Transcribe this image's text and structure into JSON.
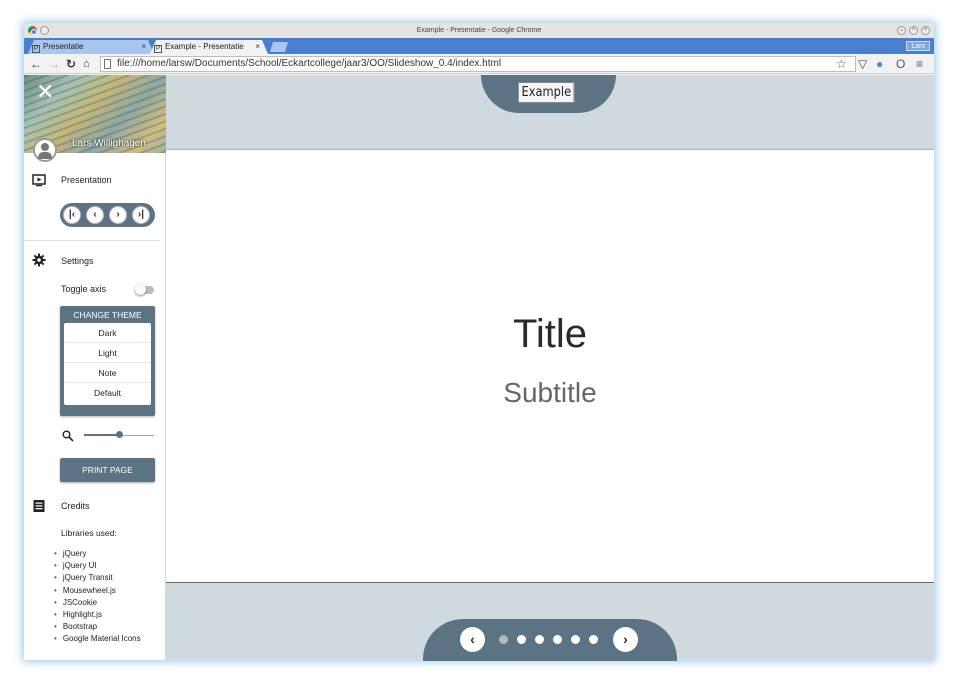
{
  "browser": {
    "window_title": "Example - Presentatie - Google Chrome",
    "tabs": [
      {
        "label": "Presentatie",
        "favicon": "P"
      },
      {
        "label": "Example - Presentatie",
        "favicon": "P"
      }
    ],
    "profile": "Lars",
    "url": "file:///home/larsw/Documents/School/Eckartcollege/jaar3/OO/Slideshow_0.4/index.html"
  },
  "sidebar": {
    "user_name": "Lars Willighagen",
    "presentation_label": "Presentation",
    "settings_label": "Settings",
    "toggle_axis_label": "Toggle axis",
    "change_theme_label": "CHANGE THEME",
    "themes": [
      "Dark",
      "Light",
      "Note",
      "Default"
    ],
    "zoom_level": 0.5,
    "print_label": "PRINT PAGE",
    "credits_label": "Credits",
    "libraries_title": "Libraries used:",
    "libraries": [
      "jQuery",
      "jQuery UI",
      "jQuery Transit",
      "Mousewheel.js",
      "JSCookie",
      "Highlight.js",
      "Bootstrap",
      "Google Material Icons"
    ]
  },
  "main": {
    "header_title": "Example",
    "slide_title": "Title",
    "slide_subtitle": "Subtitle",
    "slide_count": 6,
    "current_slide": 1
  },
  "colors": {
    "accent": "#5b7382",
    "frame_background": "#d0d9de"
  }
}
